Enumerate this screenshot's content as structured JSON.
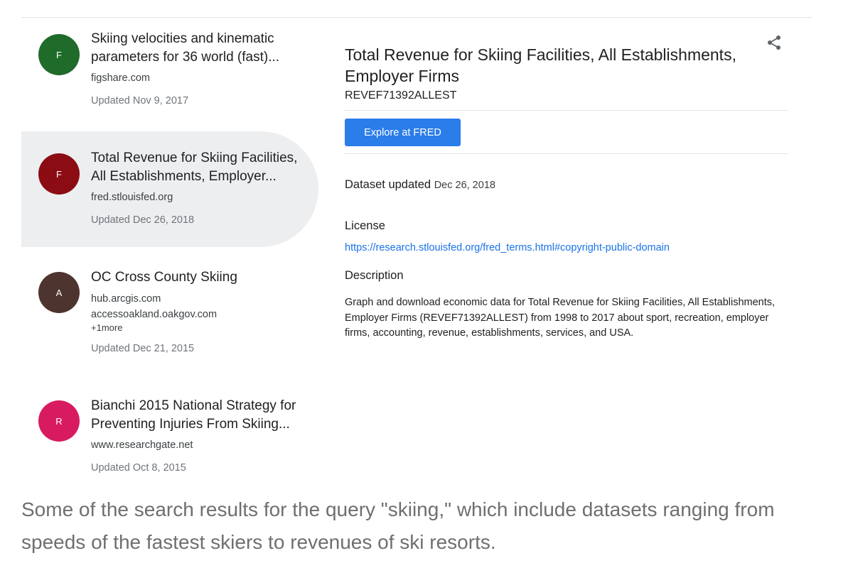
{
  "results": [
    {
      "avatar_letter": "F",
      "avatar_color": "#1f6b2a",
      "title": "Skiing velocities and kinematic parameters for 36 world (fast)...",
      "sources": [
        "figshare.com"
      ],
      "more": "",
      "updated": "Updated Nov 9, 2017",
      "selected": false
    },
    {
      "avatar_letter": "F",
      "avatar_color": "#8b0c12",
      "title": "Total Revenue for Skiing Facilities, All Establishments, Employer...",
      "sources": [
        "fred.stlouisfed.org"
      ],
      "more": "",
      "updated": "Updated Dec 26, 2018",
      "selected": true
    },
    {
      "avatar_letter": "A",
      "avatar_color": "#4e342e",
      "title": "OC Cross County Skiing",
      "sources": [
        "hub.arcgis.com",
        "accessoakland.oakgov.com"
      ],
      "more": "+1more",
      "updated": "Updated Dec 21, 2015",
      "selected": false
    },
    {
      "avatar_letter": "R",
      "avatar_color": "#d81b60",
      "title": "Bianchi 2015 National Strategy for Preventing Injuries From Skiing...",
      "sources": [
        "www.researchgate.net"
      ],
      "more": "",
      "updated": "Updated Oct 8, 2015",
      "selected": false
    }
  ],
  "detail": {
    "title": "Total Revenue for Skiing Facilities, All Establishments, Employer Firms",
    "id": "REVEF71392ALLEST",
    "share_icon": "share-icon",
    "explore_label": "Explore at FRED",
    "accent_color": "#2b7de9",
    "updated_label": "Dataset updated",
    "updated_value": "Dec 26, 2018",
    "license_label": "License",
    "license_url": "https://research.stlouisfed.org/fred_terms.html#copyright-public-domain",
    "description_label": "Description",
    "description": "Graph and download economic data for Total Revenue for Skiing Facilities, All Establishments, Employer Firms (REVEF71392ALLEST) from 1998 to 2017 about sport, recreation, employer firms, accounting, revenue, establishments, services, and USA."
  },
  "caption": "Some of the search results for the query \"skiing,\" which include datasets ranging from speeds of the fastest skiers to revenues of ski resorts."
}
